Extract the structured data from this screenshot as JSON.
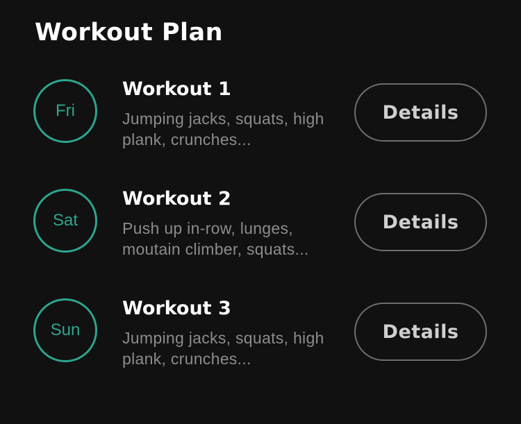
{
  "header": {
    "title": "Workout Plan"
  },
  "workouts": [
    {
      "day": "Fri",
      "title": "Workout 1",
      "description": "Jumping jacks, squats, high plank, crunches...",
      "button_label": "Details"
    },
    {
      "day": "Sat",
      "title": "Workout 2",
      "description": "Push up in-row, lunges, moutain climber, squats...",
      "button_label": "Details"
    },
    {
      "day": "Sun",
      "title": "Workout 3",
      "description": "Jumping jacks, squats, high plank, crunches...",
      "button_label": "Details"
    }
  ],
  "colors": {
    "background": "#111111",
    "accent": "#2ea58e",
    "text_primary": "#ffffff",
    "text_secondary": "#8c8c8c",
    "button_border": "#6e6e6e"
  }
}
